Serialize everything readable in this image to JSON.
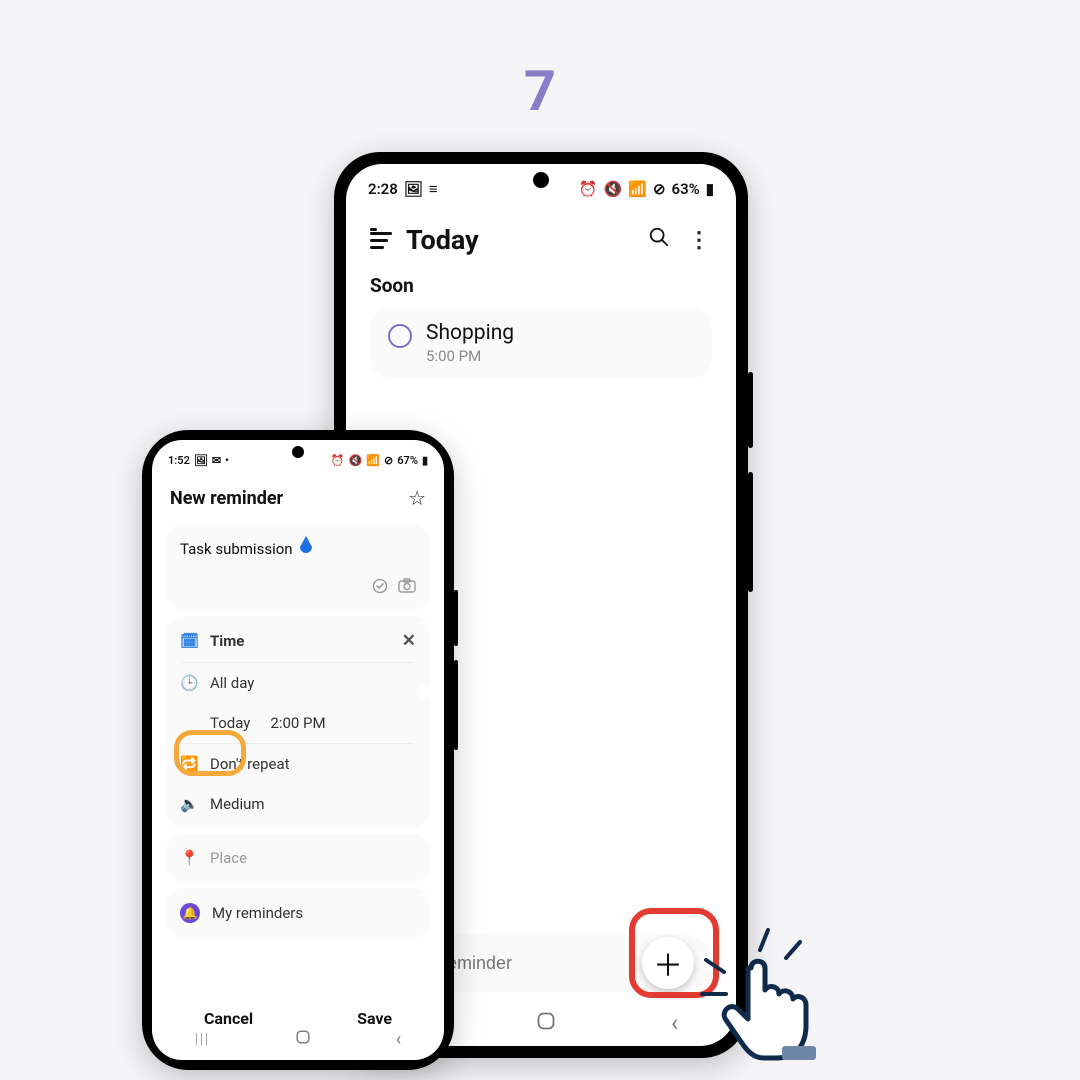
{
  "step_number": "7",
  "big_phone": {
    "status": {
      "time": "2:28",
      "battery": "63%"
    },
    "header": {
      "title": "Today"
    },
    "section_title": "Soon",
    "reminder": {
      "title": "Shopping",
      "time": "5:00 PM"
    },
    "input_placeholder": "Quick reminder",
    "nav": {
      "recents": "|||",
      "home": "◻",
      "back": "‹"
    }
  },
  "small_phone": {
    "status": {
      "time": "1:52",
      "battery": "67%"
    },
    "header": {
      "title": "New reminder"
    },
    "task_text": "Task submission",
    "time_section": {
      "label": "Time",
      "all_day": "All day",
      "date": "Today",
      "time": "2:00 PM"
    },
    "repeat": "Don't repeat",
    "alert": "Medium",
    "place": "Place",
    "list": "My reminders",
    "buttons": {
      "cancel": "Cancel",
      "save": "Save"
    }
  }
}
